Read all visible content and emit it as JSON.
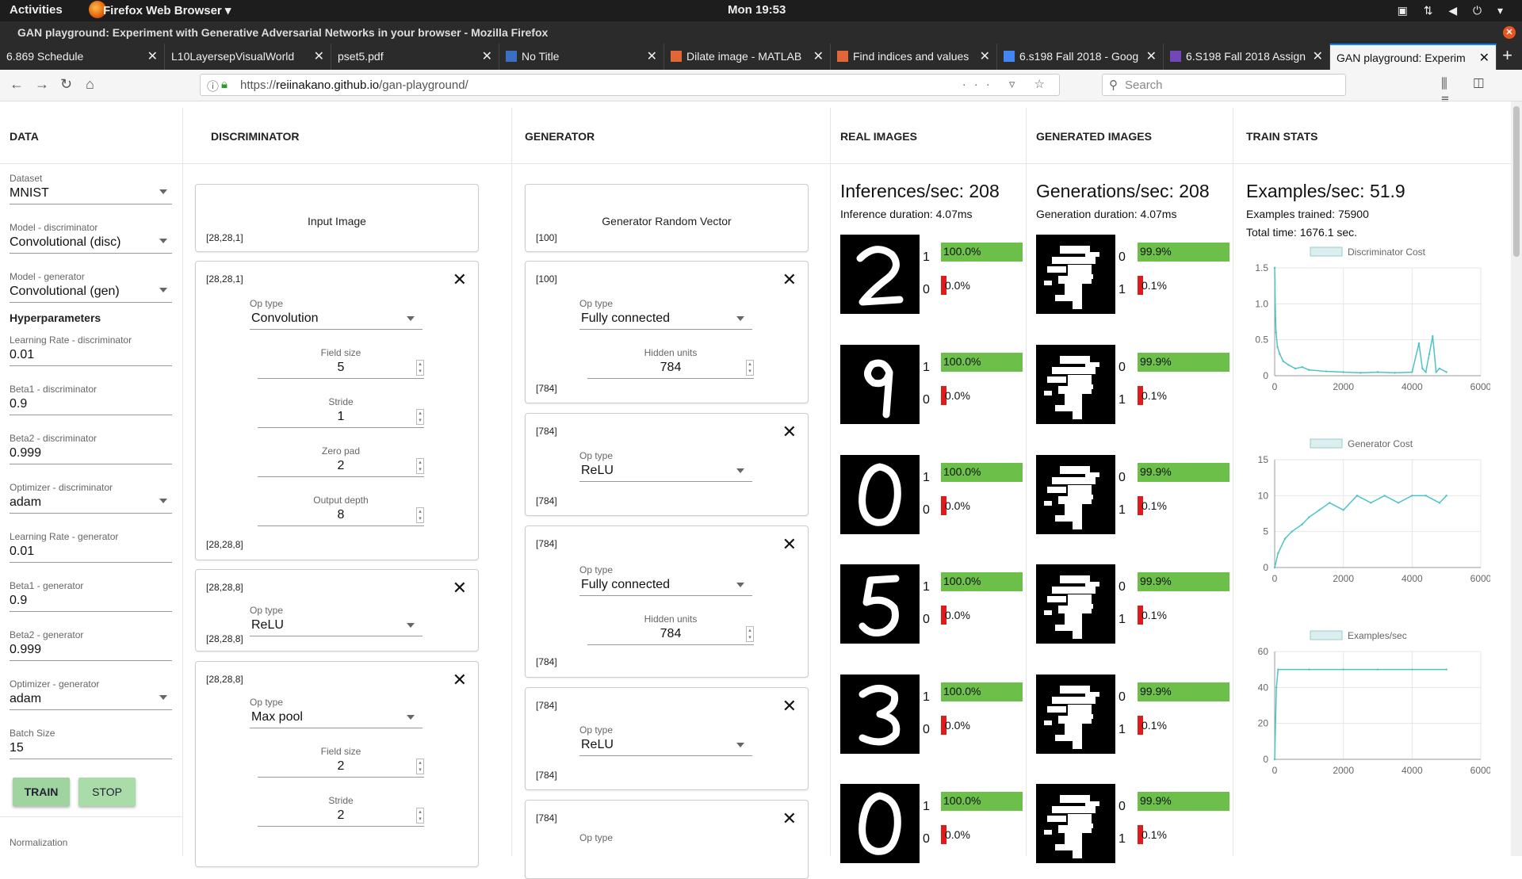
{
  "os": {
    "activities": "Activities",
    "app_menu": "Firefox Web Browser ▾",
    "clock": "Mon 19:53"
  },
  "window": {
    "title": "GAN playground: Experiment with Generative Adversarial Networks in your browser - Mozilla Firefox"
  },
  "tabs": [
    {
      "label": "6.869 Schedule"
    },
    {
      "label": "L10LayersepVisualWorld"
    },
    {
      "label": "pset5.pdf"
    },
    {
      "label": "No Title"
    },
    {
      "label": "Dilate image - MATLAB"
    },
    {
      "label": "Find indices and values"
    },
    {
      "label": "6.s198 Fall 2018 - Goog"
    },
    {
      "label": "6.S198 Fall 2018 Assign"
    },
    {
      "label": "GAN playground: Experim"
    }
  ],
  "navbar": {
    "url_prefix": "https://",
    "url_host": "reiinakano.github.io",
    "url_path": "/gan-playground/",
    "search_placeholder": "Search"
  },
  "columns": {
    "data": "DATA",
    "discriminator": "DISCRIMINATOR",
    "generator": "GENERATOR",
    "real": "REAL IMAGES",
    "generated": "GENERATED IMAGES",
    "stats": "TRAIN STATS"
  },
  "data_panel": {
    "fields": [
      {
        "label": "Dataset",
        "value": "MNIST"
      },
      {
        "label": "Model - discriminator",
        "value": "Convolutional (disc)"
      },
      {
        "label": "Model - generator",
        "value": "Convolutional (gen)"
      }
    ],
    "hyper_title": "Hyperparameters",
    "hyper": [
      {
        "label": "Learning Rate - discriminator",
        "value": "0.01"
      },
      {
        "label": "Beta1 - discriminator",
        "value": "0.9"
      },
      {
        "label": "Beta2 - discriminator",
        "value": "0.999"
      },
      {
        "label": "Optimizer - discriminator",
        "value": "adam"
      },
      {
        "label": "Learning Rate - generator",
        "value": "0.01"
      },
      {
        "label": "Beta1 - generator",
        "value": "0.9"
      },
      {
        "label": "Beta2 - generator",
        "value": "0.999"
      },
      {
        "label": "Optimizer - generator",
        "value": "adam"
      },
      {
        "label": "Batch Size",
        "value": "15"
      }
    ],
    "train": "TRAIN",
    "stop": "STOP",
    "normalization": "Normalization"
  },
  "disc": {
    "input": {
      "title": "Input Image",
      "shape": "[28,28,1]"
    },
    "conv": {
      "in": "[28,28,1]",
      "op_label": "Op type",
      "op": "Convolution",
      "fs_label": "Field size",
      "fs": "5",
      "st_label": "Stride",
      "st": "1",
      "zp_label": "Zero pad",
      "zp": "2",
      "od_label": "Output depth",
      "od": "8",
      "out": "[28,28,8]"
    },
    "relu": {
      "in": "[28,28,8]",
      "op_label": "Op type",
      "op": "ReLU",
      "out": "[28,28,8]"
    },
    "pool": {
      "in": "[28,28,8]",
      "op_label": "Op type",
      "op": "Max pool",
      "fs_label": "Field size",
      "fs": "2",
      "st_label": "Stride",
      "st": "2"
    }
  },
  "gen": {
    "input": {
      "title": "Generator Random Vector",
      "shape": "[100]"
    },
    "fc1": {
      "in": "[100]",
      "op_label": "Op type",
      "op": "Fully connected",
      "hu_label": "Hidden units",
      "hu": "784",
      "out": "[784]"
    },
    "relu1": {
      "in": "[784]",
      "op_label": "Op type",
      "op": "ReLU",
      "out": "[784]"
    },
    "fc2": {
      "in": "[784]",
      "op_label": "Op type",
      "op": "Fully connected",
      "hu_label": "Hidden units",
      "hu": "784",
      "out": "[784]"
    },
    "relu2": {
      "in": "[784]",
      "op_label": "Op type",
      "op": "ReLU",
      "out": "[784]"
    },
    "last": {
      "in": "[784]",
      "op_label": "Op type"
    }
  },
  "real": {
    "rate": "Inferences/sec: 208",
    "duration": "Inference duration: 4.07ms",
    "rows": [
      {
        "digit": "2",
        "top_label": "1",
        "top_pct": "100.0%",
        "bot_label": "0",
        "bot_pct": "0.0%"
      },
      {
        "digit": "9",
        "top_label": "1",
        "top_pct": "100.0%",
        "bot_label": "0",
        "bot_pct": "0.0%"
      },
      {
        "digit": "0",
        "top_label": "1",
        "top_pct": "100.0%",
        "bot_label": "0",
        "bot_pct": "0.0%"
      },
      {
        "digit": "5",
        "top_label": "1",
        "top_pct": "100.0%",
        "bot_label": "0",
        "bot_pct": "0.0%"
      },
      {
        "digit": "3",
        "top_label": "1",
        "top_pct": "100.0%",
        "bot_label": "0",
        "bot_pct": "0.0%"
      },
      {
        "digit": "0",
        "top_label": "1",
        "top_pct": "100.0%",
        "bot_label": "0",
        "bot_pct": "0.0%"
      }
    ]
  },
  "generated": {
    "rate": "Generations/sec: 208",
    "duration": "Generation duration: 4.07ms",
    "rows": [
      {
        "top_label": "0",
        "top_pct": "99.9%",
        "bot_label": "1",
        "bot_pct": "0.1%"
      },
      {
        "top_label": "0",
        "top_pct": "99.9%",
        "bot_label": "1",
        "bot_pct": "0.1%"
      },
      {
        "top_label": "0",
        "top_pct": "99.9%",
        "bot_label": "1",
        "bot_pct": "0.1%"
      },
      {
        "top_label": "0",
        "top_pct": "99.9%",
        "bot_label": "1",
        "bot_pct": "0.1%"
      },
      {
        "top_label": "0",
        "top_pct": "99.9%",
        "bot_label": "1",
        "bot_pct": "0.1%"
      },
      {
        "top_label": "0",
        "top_pct": "99.9%",
        "bot_label": "1",
        "bot_pct": "0.1%"
      }
    ]
  },
  "stats": {
    "rate": "Examples/sec: 51.9",
    "trained": "Examples trained: 75900",
    "time": "Total time: 1676.1 sec."
  },
  "colors": {
    "green_bar": "#6cc04a",
    "red_bar": "#e01b1b",
    "series": "#4cc3c7",
    "accent": "#0a84ff"
  },
  "chart_data": [
    {
      "type": "line",
      "title": "Discriminator Cost",
      "legend": "Discriminator Cost",
      "xlim": [
        0,
        6000
      ],
      "ylim": [
        0,
        1.5
      ],
      "xticks": [
        0,
        2000,
        4000,
        6000
      ],
      "yticks": [
        0,
        0.5,
        1.0,
        1.5
      ],
      "ytick_labels": [
        "0",
        "0.5",
        "1.0",
        "1.5"
      ],
      "x": [
        0,
        20,
        40,
        80,
        150,
        250,
        400,
        600,
        800,
        1000,
        1500,
        2000,
        2500,
        3000,
        3500,
        4000,
        4200,
        4300,
        4400,
        4500,
        4600,
        4700,
        4800,
        5000
      ],
      "y": [
        1.5,
        0.9,
        0.6,
        0.4,
        0.3,
        0.2,
        0.15,
        0.1,
        0.12,
        0.08,
        0.06,
        0.05,
        0.04,
        0.05,
        0.04,
        0.05,
        0.45,
        0.1,
        0.05,
        0.3,
        0.55,
        0.05,
        0.1,
        0.05
      ]
    },
    {
      "type": "line",
      "title": "Generator Cost",
      "legend": "Generator Cost",
      "xlim": [
        0,
        6000
      ],
      "ylim": [
        0,
        15
      ],
      "xticks": [
        0,
        2000,
        4000,
        6000
      ],
      "yticks": [
        0,
        5,
        10,
        15
      ],
      "ytick_labels": [
        "0",
        "5",
        "10",
        "15"
      ],
      "x": [
        0,
        100,
        300,
        500,
        800,
        1000,
        1300,
        1600,
        2000,
        2400,
        2800,
        3200,
        3600,
        4000,
        4400,
        4800,
        5000
      ],
      "y": [
        0,
        2,
        4,
        5,
        6,
        7,
        8,
        9,
        8,
        10,
        9,
        10,
        9,
        10,
        10,
        9,
        10
      ]
    },
    {
      "type": "line",
      "title": "Examples/sec",
      "legend": "Examples/sec",
      "xlim": [
        0,
        6000
      ],
      "ylim": [
        0,
        60
      ],
      "xticks": [
        0,
        2000,
        4000,
        6000
      ],
      "yticks": [
        0,
        20,
        40,
        60
      ],
      "ytick_labels": [
        "0",
        "20",
        "40",
        "60"
      ],
      "x": [
        0,
        50,
        100,
        1000,
        2000,
        3000,
        4000,
        5000
      ],
      "y": [
        0,
        40,
        50,
        50,
        50,
        50,
        50,
        50
      ]
    }
  ]
}
